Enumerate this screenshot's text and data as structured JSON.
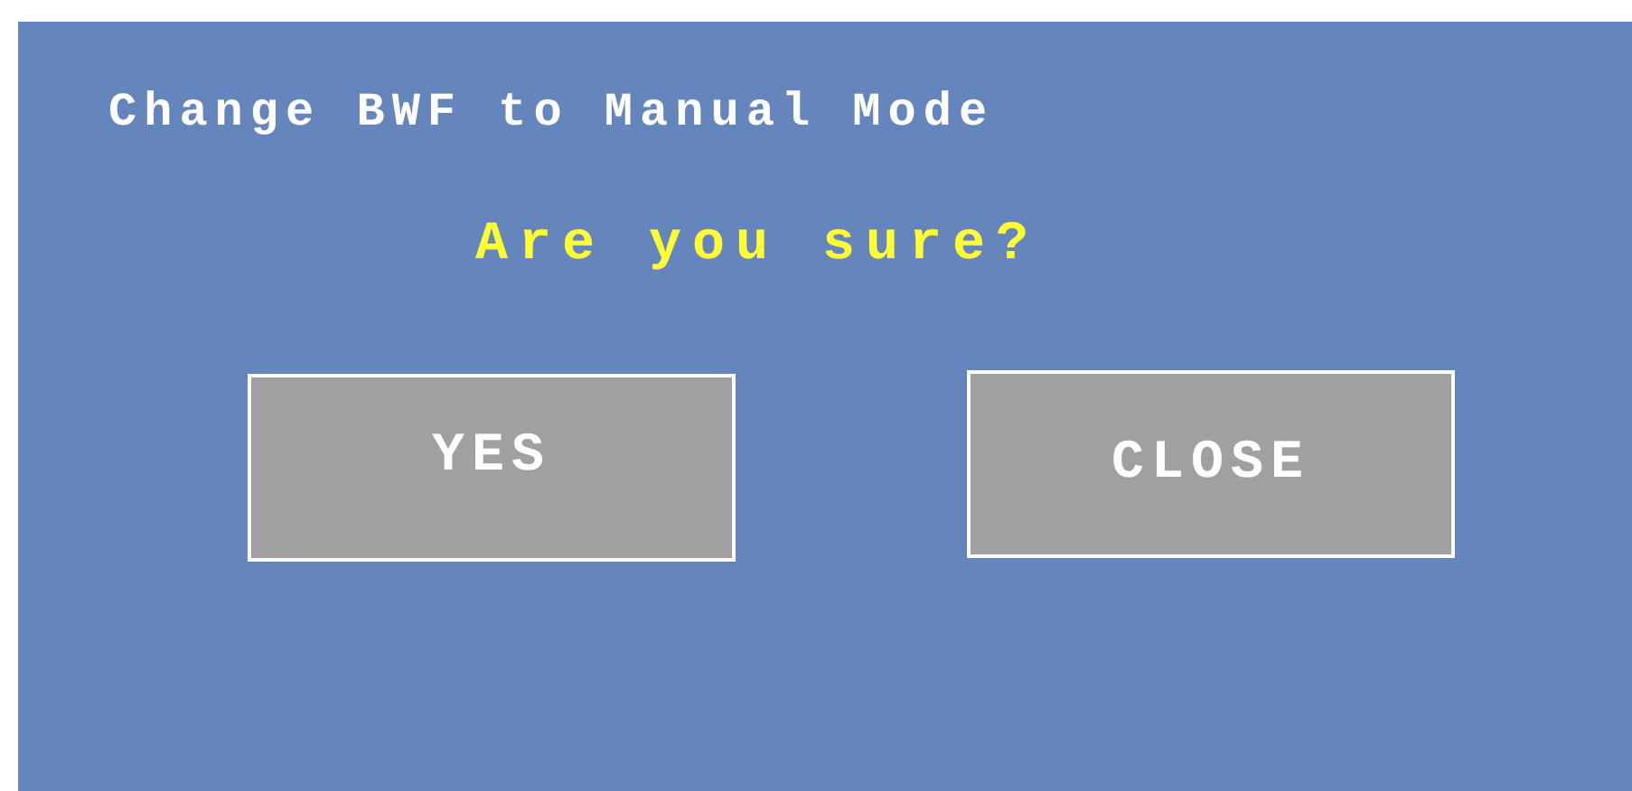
{
  "dialog": {
    "title": "Change BWF to Manual Mode",
    "question": "Are you sure?",
    "buttons": [
      "YES",
      "CLOSE"
    ]
  }
}
